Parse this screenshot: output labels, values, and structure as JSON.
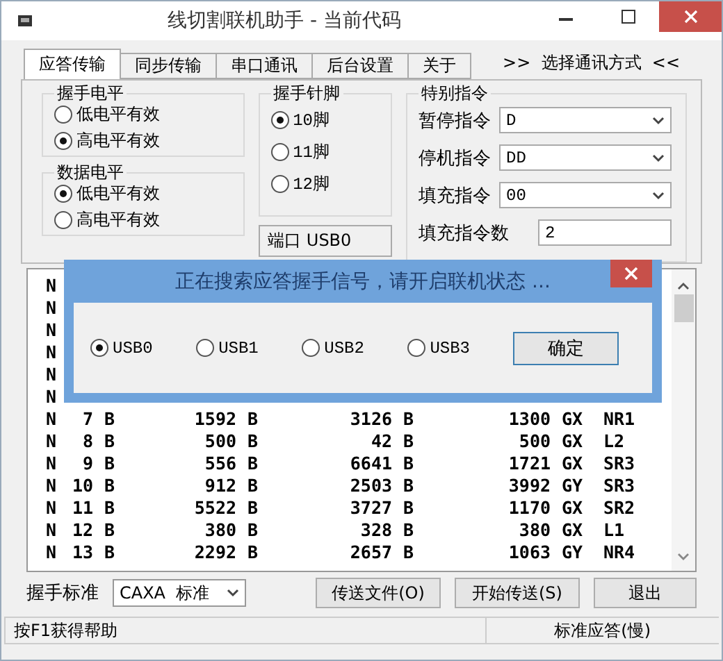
{
  "window": {
    "title": "线切割联机助手 - 当前代码"
  },
  "tabs": [
    {
      "label": "应答传输",
      "selected": true
    },
    {
      "label": "同步传输",
      "selected": false
    },
    {
      "label": "串口通讯",
      "selected": false
    },
    {
      "label": "后台设置",
      "selected": false
    },
    {
      "label": "关于",
      "selected": false
    }
  ],
  "comm_mode_label": ">>  选择通讯方式  <<",
  "handshake_level": {
    "title": "握手电平",
    "options": [
      {
        "label": "低电平有效",
        "selected": false
      },
      {
        "label": "高电平有效",
        "selected": true
      }
    ]
  },
  "data_level": {
    "title": "数据电平",
    "options": [
      {
        "label": "低电平有效",
        "selected": true
      },
      {
        "label": "高电平有效",
        "selected": false
      }
    ]
  },
  "handshake_pin": {
    "title": "握手针脚",
    "options": [
      {
        "label": "10脚",
        "selected": true
      },
      {
        "label": "11脚",
        "selected": false
      },
      {
        "label": "12脚",
        "selected": false
      }
    ]
  },
  "port": "端口 USB0",
  "special_commands": {
    "title": "特别指令",
    "fields": [
      {
        "label": "暂停指令",
        "value": "D",
        "kind": "select"
      },
      {
        "label": "停机指令",
        "value": "DD",
        "kind": "select"
      },
      {
        "label": "填充指令",
        "value": "00",
        "kind": "select"
      },
      {
        "label": "填充指令数",
        "value": "2",
        "kind": "input"
      }
    ]
  },
  "listing": {
    "rows": [
      [
        "N"
      ],
      [
        "N"
      ],
      [
        "N"
      ],
      [
        "N"
      ],
      [
        "N"
      ],
      [
        "N"
      ],
      [
        "N",
        "7",
        "B",
        "1592",
        "B",
        "3126",
        "B",
        "1300",
        "GX",
        "NR1"
      ],
      [
        "N",
        "8",
        "B",
        "500",
        "B",
        "42",
        "B",
        "500",
        "GX",
        "L2"
      ],
      [
        "N",
        "9",
        "B",
        "556",
        "B",
        "6641",
        "B",
        "1721",
        "GX",
        "SR3"
      ],
      [
        "N",
        "10",
        "B",
        "912",
        "B",
        "2503",
        "B",
        "3992",
        "GY",
        "SR3"
      ],
      [
        "N",
        "11",
        "B",
        "5522",
        "B",
        "3727",
        "B",
        "1170",
        "GX",
        "SR2"
      ],
      [
        "N",
        "12",
        "B",
        "380",
        "B",
        "328",
        "B",
        "380",
        "GX",
        "L1"
      ],
      [
        "N",
        "13",
        "B",
        "2292",
        "B",
        "2657",
        "B",
        "1063",
        "GY",
        "NR4"
      ]
    ]
  },
  "footer": {
    "handshake_label": "握手标准",
    "handshake_value": "CAXA  标准",
    "buttons": [
      "传送文件(O)",
      "开始传送(S)",
      "退出"
    ]
  },
  "status_bar": [
    "按F1获得帮助",
    "标准应答(慢)"
  ],
  "dialog": {
    "title": "正在搜索应答握手信号，请开启联机状态 ...",
    "options": [
      {
        "label": "USB0",
        "selected": true
      },
      {
        "label": "USB1",
        "selected": false
      },
      {
        "label": "USB2",
        "selected": false
      },
      {
        "label": "USB3",
        "selected": false
      }
    ],
    "button": "确定"
  }
}
